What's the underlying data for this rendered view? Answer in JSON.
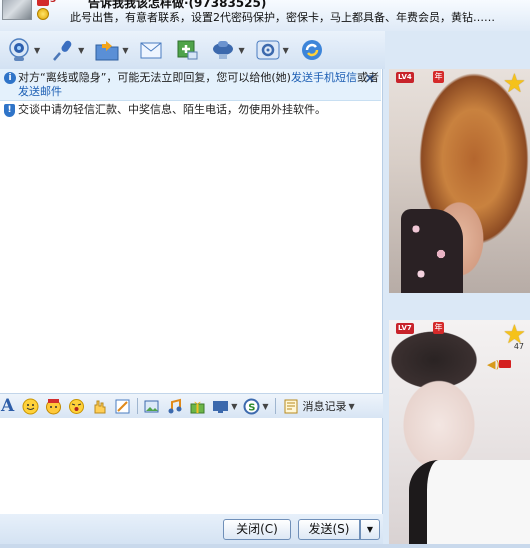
{
  "header": {
    "contact_name": "告诉我我该怎样做·(97383525)",
    "level_indicator": "3",
    "signature": "此号出售，有意者联系，设置2代密码保护，密保卡，马上都具备、年费会员，黄钻……"
  },
  "toolbar": {
    "items": [
      {
        "icon": "video-camera-icon"
      },
      {
        "icon": "microphone-icon"
      },
      {
        "icon": "send-file-icon"
      },
      {
        "icon": "send-email-icon"
      },
      {
        "icon": "create-group-icon"
      },
      {
        "icon": "remote-assist-icon"
      },
      {
        "icon": "settings-icon"
      },
      {
        "icon": "app-center-icon"
      }
    ]
  },
  "notice": {
    "text_before": "对方“离线或隐身”，可能无法立即回复，您可以给他(她)",
    "link_sms": "发送手机短信",
    "text_mid": "或者",
    "link_email": "发送邮件",
    "close_glyph": "×"
  },
  "warning": {
    "text": "交谈中请勿轻信汇款、中奖信息、陌生电话，勿使用外挂软件。"
  },
  "input_toolbar": {
    "font_label": "A",
    "items": [
      "emoticon-icon",
      "magic-face-icon",
      "shake-window-icon",
      "gesture-icon",
      "edit-image-icon",
      "screenshot-icon",
      "music-icon",
      "gift-icon",
      "screen-share-icon",
      "search-icon"
    ],
    "history_label": "消息记录"
  },
  "footer": {
    "close_label": "关闭(C)",
    "send_label": "发送(S)",
    "send_options_glyph": "▼"
  },
  "video": {
    "remote": {
      "level": "LV4",
      "year": "年"
    },
    "local": {
      "level": "LV7",
      "year": "年",
      "star_count": "47"
    }
  },
  "colors": {
    "accent": "#2f74c8",
    "link": "#1d5fb4",
    "notice_bg": "#e4f1fc",
    "badge_red": "#c8232a"
  }
}
